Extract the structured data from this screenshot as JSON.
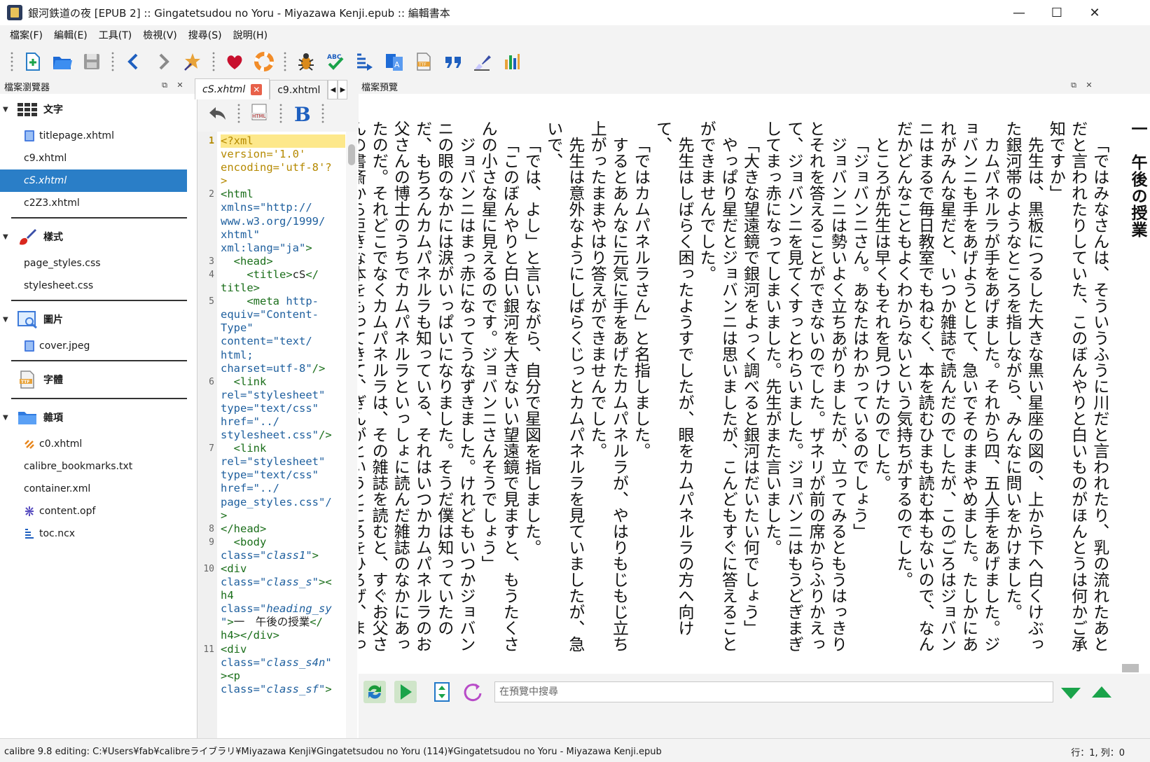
{
  "window": {
    "title": "銀河鉄道の夜 [EPUB 2] :: Gingatetsudou no Yoru - Miyazawa  Kenji.epub :: 編輯書本",
    "minimize": "—",
    "maximize": "☐",
    "close": "✕"
  },
  "menu": [
    "檔案(F)",
    "編輯(E)",
    "工具(T)",
    "檢視(V)",
    "搜尋(S)",
    "說明(H)"
  ],
  "toolbar": {
    "icons": [
      "new-file-icon",
      "open-folder-icon",
      "save-icon",
      "back-icon",
      "forward-icon",
      "checkpoint-star-icon",
      "donate-heart-icon",
      "help-lifebuoy-icon",
      "check-book-bug-icon",
      "spellcheck-icon",
      "toc-edit-icon",
      "translate-icon",
      "font-ttf-icon",
      "quote-icon",
      "cleanup-brush-icon",
      "report-icon"
    ]
  },
  "file_browser": {
    "title": "檔案瀏覽器",
    "sections": [
      {
        "name": "文字",
        "icon": "text-files-icon",
        "files": [
          {
            "name": "titlepage.xhtml",
            "icon": "xhtml-file-icon",
            "selected": false
          },
          {
            "name": "c9.xhtml",
            "icon": "",
            "selected": false
          },
          {
            "name": "cS.xhtml",
            "icon": "",
            "selected": true
          },
          {
            "name": "c2Z3.xhtml",
            "icon": "",
            "selected": false
          }
        ]
      },
      {
        "name": "樣式",
        "icon": "style-brush-icon",
        "files": [
          {
            "name": "page_styles.css",
            "icon": "",
            "selected": false
          },
          {
            "name": "stylesheet.css",
            "icon": "",
            "selected": false
          }
        ]
      },
      {
        "name": "圖片",
        "icon": "image-icon",
        "files": [
          {
            "name": "cover.jpeg",
            "icon": "jpeg-file-icon",
            "selected": false
          }
        ]
      },
      {
        "name": "字體",
        "icon": "font-icon",
        "files": []
      },
      {
        "name": "雜項",
        "icon": "misc-folder-icon",
        "files": [
          {
            "name": "c0.xhtml",
            "icon": "link-file-icon",
            "selected": false
          },
          {
            "name": "calibre_bookmarks.txt",
            "icon": "",
            "selected": false
          },
          {
            "name": "container.xml",
            "icon": "",
            "selected": false
          },
          {
            "name": "content.opf",
            "icon": "opf-file-icon",
            "selected": false
          },
          {
            "name": "toc.ncx",
            "icon": "ncx-file-icon",
            "selected": false
          }
        ]
      }
    ]
  },
  "editor": {
    "tabs": [
      {
        "label": "cS.xhtml",
        "active": true
      },
      {
        "label": "c9.xhtml",
        "active": false
      }
    ],
    "line_numbers": [
      {
        "n": "1",
        "row": 0
      },
      {
        "n": "2",
        "row": 4
      },
      {
        "n": "3",
        "row": 9
      },
      {
        "n": "4",
        "row": 10
      },
      {
        "n": "5",
        "row": 12
      },
      {
        "n": "6",
        "row": 18
      },
      {
        "n": "7",
        "row": 23
      },
      {
        "n": "8",
        "row": 29
      },
      {
        "n": "9",
        "row": 30
      },
      {
        "n": "10",
        "row": 32
      },
      {
        "n": "11",
        "row": 38
      }
    ],
    "code_lines": [
      [
        {
          "c": "pi",
          "t": "<?xml"
        }
      ],
      [
        {
          "c": "pi",
          "t": "version='1.0'"
        }
      ],
      [
        {
          "c": "pi",
          "t": "encoding='utf-8'?"
        }
      ],
      [
        {
          "c": "pi",
          "t": ">"
        }
      ],
      [
        {
          "c": "tg",
          "t": "<html"
        }
      ],
      [
        {
          "c": "at",
          "t": "xmlns=\"http://"
        }
      ],
      [
        {
          "c": "at",
          "t": "www.w3.org/1999/"
        }
      ],
      [
        {
          "c": "at",
          "t": "xhtml\""
        }
      ],
      [
        {
          "c": "at",
          "t": "xml:lang=\"ja\""
        },
        {
          "c": "tg",
          "t": ">"
        }
      ],
      [
        {
          "c": "tg",
          "t": "  <head>"
        }
      ],
      [
        {
          "c": "tg",
          "t": "    <title>"
        },
        {
          "c": "tx",
          "t": "cS"
        },
        {
          "c": "tg",
          "t": "</"
        }
      ],
      [
        {
          "c": "tg",
          "t": "title>"
        }
      ],
      [
        {
          "c": "tg",
          "t": "    <meta "
        },
        {
          "c": "at",
          "t": "http-"
        }
      ],
      [
        {
          "c": "at",
          "t": "equiv=\"Content-"
        }
      ],
      [
        {
          "c": "at",
          "t": "Type\""
        }
      ],
      [
        {
          "c": "at",
          "t": "content=\"text/"
        }
      ],
      [
        {
          "c": "at",
          "t": "html;"
        }
      ],
      [
        {
          "c": "at",
          "t": "charset=utf-8\""
        },
        {
          "c": "tg",
          "t": "/>"
        }
      ],
      [
        {
          "c": "tg",
          "t": "  <link"
        }
      ],
      [
        {
          "c": "at",
          "t": "rel=\"stylesheet\""
        }
      ],
      [
        {
          "c": "at",
          "t": "type=\"text/css\""
        }
      ],
      [
        {
          "c": "at",
          "t": "href=\"../"
        }
      ],
      [
        {
          "c": "av",
          "t": "stylesheet.css"
        },
        {
          "c": "at",
          "t": "\""
        },
        {
          "c": "tg",
          "t": "/>"
        }
      ],
      [
        {
          "c": "tg",
          "t": "  <link"
        }
      ],
      [
        {
          "c": "at",
          "t": "rel=\"stylesheet\""
        }
      ],
      [
        {
          "c": "at",
          "t": "type=\"text/css\""
        }
      ],
      [
        {
          "c": "at",
          "t": "href=\"../"
        }
      ],
      [
        {
          "c": "av",
          "t": "page_styles.css"
        },
        {
          "c": "at",
          "t": "\"/"
        }
      ],
      [
        {
          "c": "tg",
          "t": ">"
        }
      ],
      [
        {
          "c": "tg",
          "t": "</head>"
        }
      ],
      [
        {
          "c": "tg",
          "t": "  <body"
        }
      ],
      [
        {
          "c": "at",
          "t": "class="
        },
        {
          "c": "ai",
          "t": "\"class1\""
        },
        {
          "c": "tg",
          "t": ">"
        }
      ],
      [
        {
          "c": "tg",
          "t": "<div"
        }
      ],
      [
        {
          "c": "at",
          "t": "class="
        },
        {
          "c": "ai",
          "t": "\"class_s\""
        },
        {
          "c": "tg",
          "t": "><"
        }
      ],
      [
        {
          "c": "tg",
          "t": "h4"
        }
      ],
      [
        {
          "c": "at",
          "t": "class="
        },
        {
          "c": "ai",
          "t": "\"heading_sy"
        }
      ],
      [
        {
          "c": "ai",
          "t": "\""
        },
        {
          "c": "tg",
          "t": ">"
        },
        {
          "c": "tx",
          "t": "一　午後の授業"
        },
        {
          "c": "tg",
          "t": "</"
        }
      ],
      [
        {
          "c": "tg",
          "t": "h4></div>"
        }
      ],
      [
        {
          "c": "tg",
          "t": "<div"
        }
      ],
      [
        {
          "c": "at",
          "t": "class="
        },
        {
          "c": "ai",
          "t": "\"class_s4n\""
        }
      ],
      [
        {
          "c": "tg",
          "t": "><p"
        }
      ],
      [
        {
          "c": "at",
          "t": "class="
        },
        {
          "c": "ai",
          "t": "\"class_sf\""
        },
        {
          "c": "tg",
          "t": ">"
        }
      ]
    ]
  },
  "preview": {
    "title": "檔案預覽",
    "heading": "一　午後の授業",
    "paragraphs": [
      "「ではみなさんは、そういうふうに川だと言われたり、乳の流れたあとだと言われたりしていた、このぼんやりと白いものがほんとうは何かご承知ですか」",
      "先生は、黒板につるした大きな黒い星座の図の、上から下へ白くけぶった銀河帯のようなところを指しながら、みんなに問いをかけました。",
      "カムパネルラが手をあげました。それから四、五人手をあげました。ジョバンニも手をあげようとして、急いでそのままやめました。たしかにあれがみんな星だと、いつか雑誌で読んだのでしたが、このごろはジョバンニはまるで毎日教室でもねむく、本を読むひまも読む本もないので、なんだかどんなこともよくわからないという気持ちがするのでした。",
      "ところが先生は早くもそれを見つけたのでした。",
      "「ジョバンニさん。あなたはわかっているのでしょう」",
      "ジョバンニは勢いよく立ちあがりましたが、立ってみるともうはっきりとそれを答えることができないのでした。ザネリが前の席からふりかえって、ジョバンニを見てくすっとわらいました。ジョバンニはもうどぎまぎしてまっ赤になってしまいました。先生がまた言いました。",
      "「大きな望遠鏡で銀河をよっく調べると銀河はだいたい何でしょう」",
      "やっぱり星だとジョバンニは思いましたが、こんどもすぐに答えることができませんでした。",
      "先生はしばらく困ったようすでしたが、眼をカムパネルラの方へ向けて、",
      "「ではカムパネルラさん」と名指しました。",
      "するとあんなに元気に手をあげたカムパネルラが、やはりもじもじ立ち上がったままやはり答えができませんでした。",
      "先生は意外なようにしばらくじっとカムパネルラを見ていましたが、急いで、",
      "「では、よし」と言いながら、自分で星図を指しました。",
      "「このぼんやりと白い銀河を大きないい望遠鏡で見ますと、もうたくさんの小さな星に見えるのです。ジョバンニさんそうでしょう」",
      "ジョバンニはまっ赤になってうなずきました。けれどもいつかジョバンニの眼のなかには涙がいっぱいになりました。そうだ僕は知っていたのだ、もちろんカムパネルラも知っている、それはいつかカムパネルラのお父さんの博士のうちでカムパネルラといっしょに読んだ雑誌のなかにあったのだ。それどこでなくカムパネルラは、その雑誌を読むと、すぐお父さんの書斎から巨きな本をもってきて、ぎんがというところをひろげ、まっ黒な頁いっぱいに白に点々のある美しい写真を二人でいつまでも見たのでした。それをカムパネルラが忘れるはずもなかったのに、すぐに返事をしなかったのは、このごろぼくが、朝に"
    ],
    "search_placeholder": "在預覽中搜尋"
  },
  "status": {
    "path": "calibre 9.8 editing: C:¥Users¥fab¥calibreライブラリ¥Miyazawa  Kenji¥Gingatetsudou no Yoru (114)¥Gingatetsudou no Yoru - Miyazawa  Kenji.epub",
    "position": "行：1, 列：0"
  },
  "colors": {
    "selection": "#2a7ec7",
    "current_line": "#fde88b"
  }
}
